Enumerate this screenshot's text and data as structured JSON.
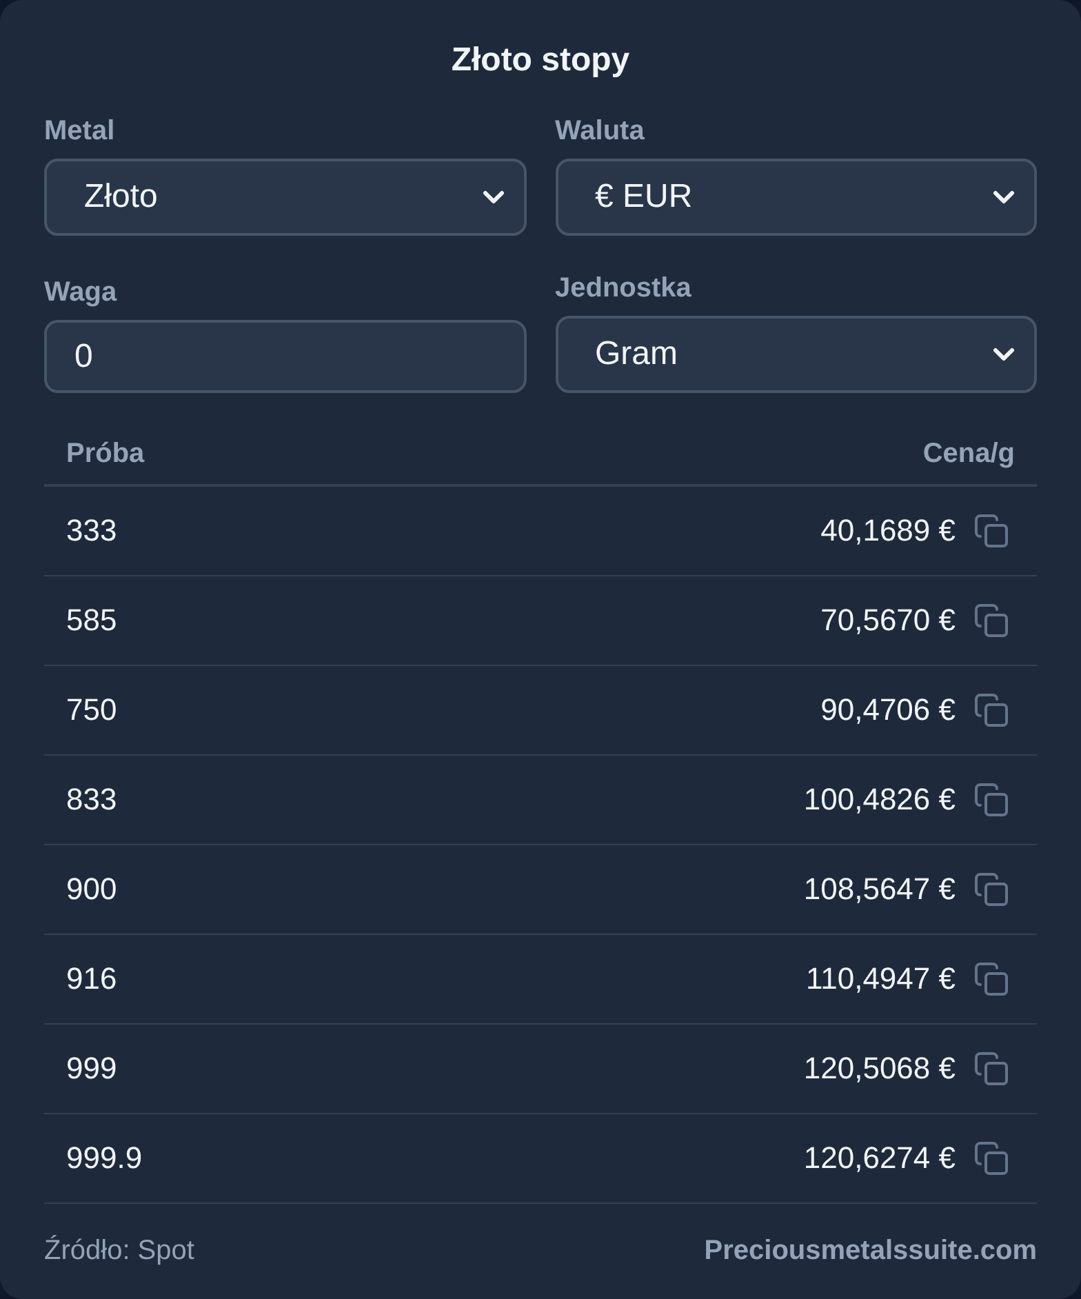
{
  "title": "Złoto stopy",
  "fields": [
    {
      "kind": "select",
      "label": "Metal",
      "value": "Złoto"
    },
    {
      "kind": "select",
      "label": "Waluta",
      "value": "€ EUR"
    },
    {
      "kind": "input",
      "label": "Waga",
      "value": "0"
    },
    {
      "kind": "select",
      "label": "Jednostka",
      "value": "Gram"
    }
  ],
  "table": {
    "columns": [
      "Próba",
      "Cena/g"
    ],
    "rows": [
      {
        "purity": "333",
        "price": "40,1689 €"
      },
      {
        "purity": "585",
        "price": "70,5670 €"
      },
      {
        "purity": "750",
        "price": "90,4706 €"
      },
      {
        "purity": "833",
        "price": "100,4826 €"
      },
      {
        "purity": "900",
        "price": "108,5647 €"
      },
      {
        "purity": "916",
        "price": "110,4947 €"
      },
      {
        "purity": "999",
        "price": "120,5068 €"
      },
      {
        "purity": "999.9",
        "price": "120,6274 €"
      }
    ]
  },
  "footer": {
    "source": "Źródło: Spot",
    "link": "Preciousmetalssuite.com"
  }
}
